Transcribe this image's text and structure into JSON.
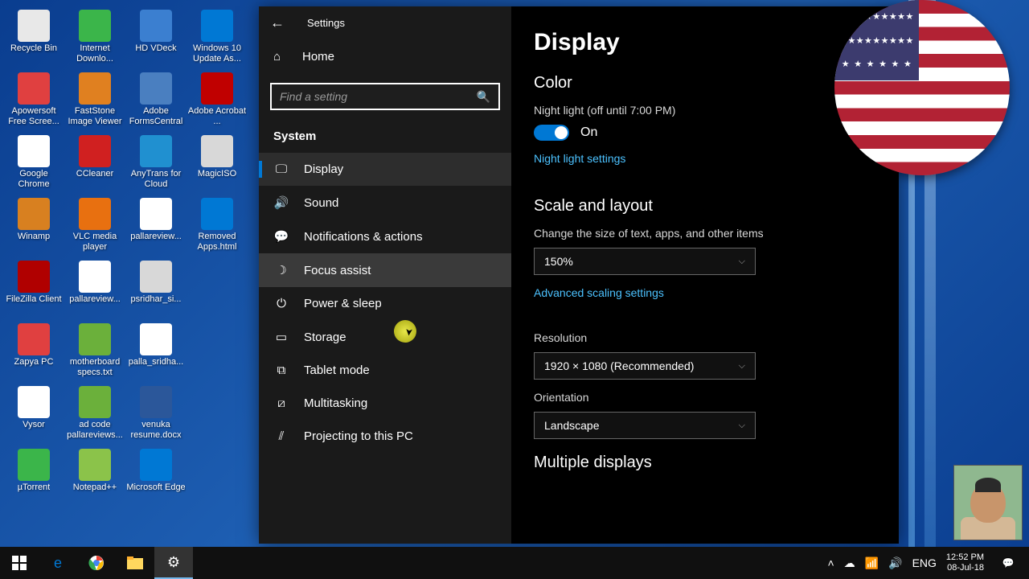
{
  "desktop_icons": [
    {
      "label": "Recycle Bin",
      "color": "#e8e8e8"
    },
    {
      "label": "Apowersoft Free Scree...",
      "color": "#e04040"
    },
    {
      "label": "Google Chrome",
      "color": "#fff"
    },
    {
      "label": "Winamp",
      "color": "#d88020"
    },
    {
      "label": "FileZilla Client",
      "color": "#b00000"
    },
    {
      "label": "Zapya PC",
      "color": "#e04040"
    },
    {
      "label": "Vysor",
      "color": "#fff"
    },
    {
      "label": "µTorrent",
      "color": "#3bb54a"
    },
    {
      "label": "Internet Downlo...",
      "color": "#3bb54a"
    },
    {
      "label": "FastStone Image Viewer",
      "color": "#e08020"
    },
    {
      "label": "CCleaner",
      "color": "#d02020"
    },
    {
      "label": "VLC media player",
      "color": "#e87010"
    },
    {
      "label": "pallareview...",
      "color": "#fff"
    },
    {
      "label": "motherboard specs.txt",
      "color": "#6bb03b"
    },
    {
      "label": "ad code pallareviews...",
      "color": "#6bb03b"
    },
    {
      "label": "Notepad++",
      "color": "#8bc34a"
    },
    {
      "label": "HD VDeck",
      "color": "#3b7fd0"
    },
    {
      "label": "Adobe FormsCentral",
      "color": "#4a7fc0"
    },
    {
      "label": "AnyTrans for Cloud",
      "color": "#2090d0"
    },
    {
      "label": "pallareview...",
      "color": "#fff"
    },
    {
      "label": "psridhar_si...",
      "color": "#d8d8d8"
    },
    {
      "label": "palla_sridha...",
      "color": "#fff"
    },
    {
      "label": "venuka resume.docx",
      "color": "#2b579a"
    },
    {
      "label": "Microsoft Edge",
      "color": "#0078d4"
    },
    {
      "label": "Windows 10 Update As...",
      "color": "#0078d4"
    },
    {
      "label": "Adobe Acrobat ...",
      "color": "#c00000"
    },
    {
      "label": "MagicISO",
      "color": "#d8d8d8"
    },
    {
      "label": "Removed Apps.html",
      "color": "#0078d4"
    }
  ],
  "settings": {
    "window_title": "Settings",
    "home": "Home",
    "search_placeholder": "Find a setting",
    "category": "System",
    "nav": [
      {
        "icon": "🖵",
        "label": "Display",
        "selected": true
      },
      {
        "icon": "🔊",
        "label": "Sound"
      },
      {
        "icon": "💬",
        "label": "Notifications & actions"
      },
      {
        "icon": "☽",
        "label": "Focus assist",
        "hovered": true
      },
      {
        "icon": "⏻",
        "label": "Power & sleep"
      },
      {
        "icon": "▭",
        "label": "Storage"
      },
      {
        "icon": "⧉",
        "label": "Tablet mode"
      },
      {
        "icon": "⧄",
        "label": "Multitasking"
      },
      {
        "icon": "⫽",
        "label": "Projecting to this PC"
      }
    ],
    "page": {
      "title": "Display",
      "color_section": "Color",
      "night_light_label": "Night light (off until 7:00 PM)",
      "toggle_state": "On",
      "night_light_link": "Night light settings",
      "scale_section": "Scale and layout",
      "scale_label": "Change the size of text, apps, and other items",
      "scale_value": "150%",
      "scale_link": "Advanced scaling settings",
      "resolution_label": "Resolution",
      "resolution_value": "1920 × 1080 (Recommended)",
      "orientation_label": "Orientation",
      "orientation_value": "Landscape",
      "multiple_section": "Multiple displays"
    }
  },
  "taskbar": {
    "lang": "ENG",
    "time": "12:52 PM",
    "date": "08-Jul-18"
  }
}
